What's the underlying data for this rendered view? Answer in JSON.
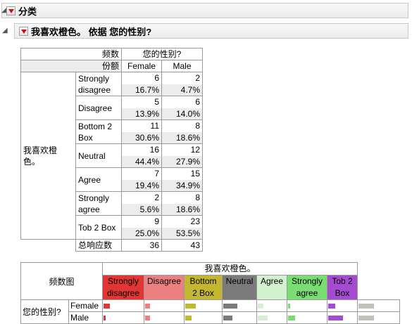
{
  "outline1": {
    "title": "分类"
  },
  "outline2": {
    "title": "我喜欢橙色。 依据 您的性别?"
  },
  "table": {
    "corner_count": "频数",
    "corner_share": "份额",
    "col_group": "您的性别?",
    "cols": [
      "Female",
      "Male"
    ],
    "row_group": "我喜欢橙色。",
    "rows": [
      {
        "label1": "Strongly",
        "label2": "disagree",
        "f_count": "6",
        "m_count": "2",
        "f_pct": "16.7%",
        "m_pct": "4.7%"
      },
      {
        "label1": "Disagree",
        "label2": "",
        "f_count": "5",
        "m_count": "6",
        "f_pct": "13.9%",
        "m_pct": "14.0%"
      },
      {
        "label1": "Bottom 2",
        "label2": "Box",
        "f_count": "11",
        "m_count": "8",
        "f_pct": "30.6%",
        "m_pct": "18.6%"
      },
      {
        "label1": "Neutral",
        "label2": "",
        "f_count": "16",
        "m_count": "12",
        "f_pct": "44.4%",
        "m_pct": "27.9%"
      },
      {
        "label1": "Agree",
        "label2": "",
        "f_count": "7",
        "m_count": "15",
        "f_pct": "19.4%",
        "m_pct": "34.9%"
      },
      {
        "label1": "Strongly",
        "label2": "agree",
        "f_count": "2",
        "m_count": "8",
        "f_pct": "5.6%",
        "m_pct": "18.6%"
      },
      {
        "label1": "Tob 2 Box",
        "label2": "",
        "f_count": "9",
        "m_count": "23",
        "f_pct": "25.0%",
        "m_pct": "53.5%"
      }
    ],
    "total_label": "总响应数",
    "total_f": "36",
    "total_m": "43"
  },
  "mosaic": {
    "corner": "频数图",
    "header": "我喜欢橙色。",
    "categories": [
      {
        "l1": "Strongly",
        "l2": "disagree",
        "color": "#e23636"
      },
      {
        "l1": "Disagree",
        "l2": "",
        "color": "#ec7f7f"
      },
      {
        "l1": "Bottom",
        "l2": "2 Box",
        "color": "#c3b732"
      },
      {
        "l1": "Neutral",
        "l2": "",
        "color": "#7a7a7a"
      },
      {
        "l1": "Agree",
        "l2": "",
        "color": "#d3f0cf"
      },
      {
        "l1": "Strongly",
        "l2": "agree",
        "color": "#79dd74"
      },
      {
        "l1": "Tob 2",
        "l2": "Box",
        "color": "#a44bd1"
      },
      {
        "l1": "",
        "l2": "",
        "color": "#c2c2bb"
      }
    ],
    "row_group": "您的性别?",
    "rows": [
      {
        "label": "Female",
        "fractions": [
          0.167,
          0.139,
          0.306,
          0.444,
          0.194,
          0.056,
          0.25,
          0.4
        ]
      },
      {
        "label": "Male",
        "fractions": [
          0.047,
          0.14,
          0.186,
          0.279,
          0.349,
          0.186,
          0.535,
          0.4
        ]
      }
    ]
  }
}
